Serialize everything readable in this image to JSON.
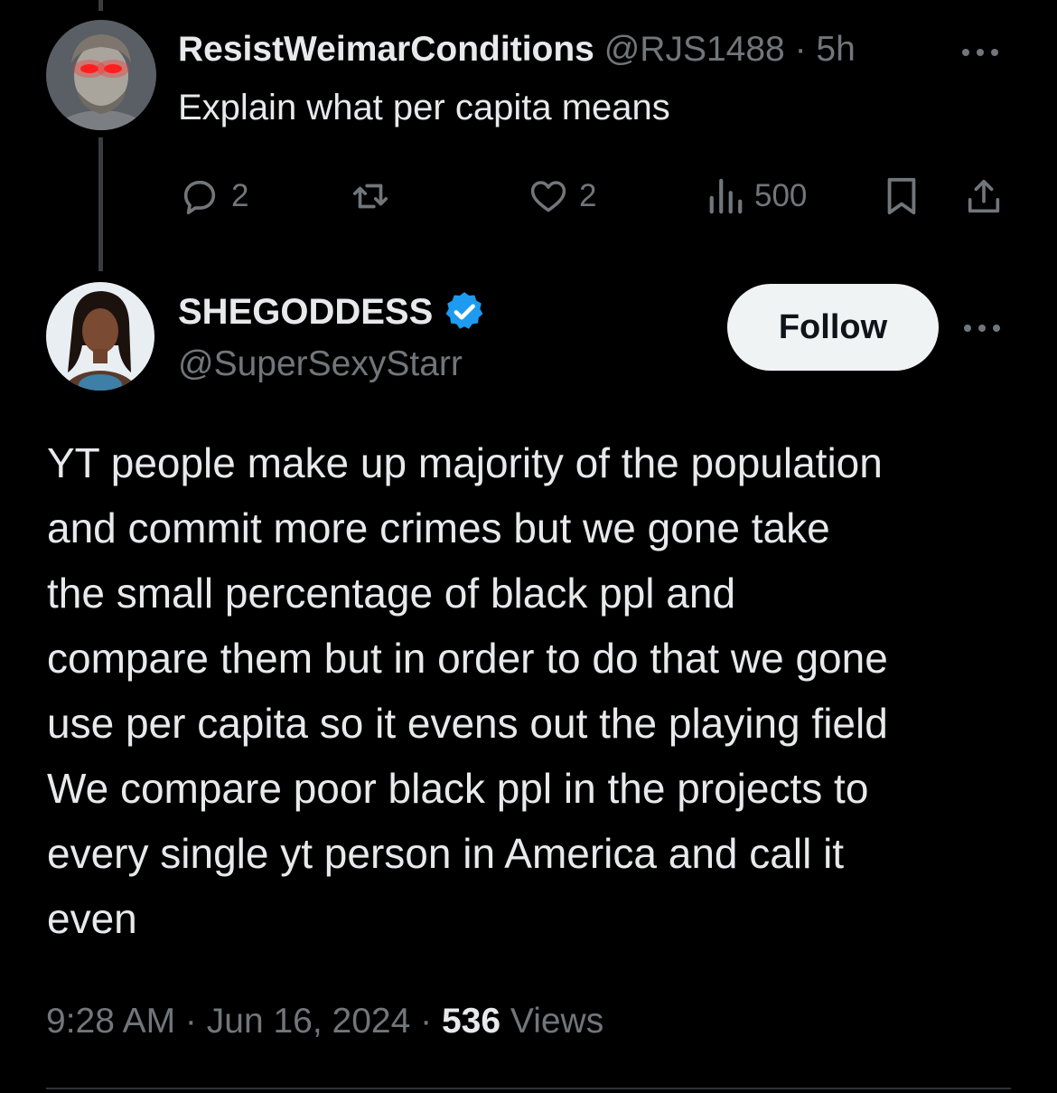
{
  "parent_tweet": {
    "display_name": "ResistWeimarConditions",
    "handle": "@RJS1488",
    "separator": " · ",
    "time": "5h",
    "text": "Explain what per capita means",
    "avatar_icon": "avatar-classical-bust-red-laser-eyes",
    "actions": {
      "replies": "2",
      "retweets": "",
      "likes": "2",
      "views": "500"
    }
  },
  "main_tweet": {
    "display_name": "SHEGODDESS",
    "verified": true,
    "handle": "@SuperSexyStarr",
    "follow_label": "Follow",
    "avatar_icon": "avatar-woman-photo",
    "body_lines": [
      "YT people make up majority of the population",
      "and commit more crimes but we gone take",
      "the small percentage of black ppl and",
      "compare them but in order to do that we gone",
      "use per capita so it evens out the playing field",
      "We compare poor black ppl in the projects to",
      "every single yt person in America and call it",
      "even"
    ],
    "meta": {
      "time": "9:28 AM",
      "separator1": " · ",
      "date": "Jun 16, 2024",
      "separator2": " · ",
      "views_count": "536",
      "views_label": " Views"
    }
  },
  "colors": {
    "background": "#000000",
    "text_primary": "#e7e9ea",
    "text_muted": "#71767b",
    "verified_blue": "#1d9bf0",
    "follow_bg": "#eff3f4",
    "follow_text": "#0f1419",
    "thread_line": "#3a3d40"
  }
}
